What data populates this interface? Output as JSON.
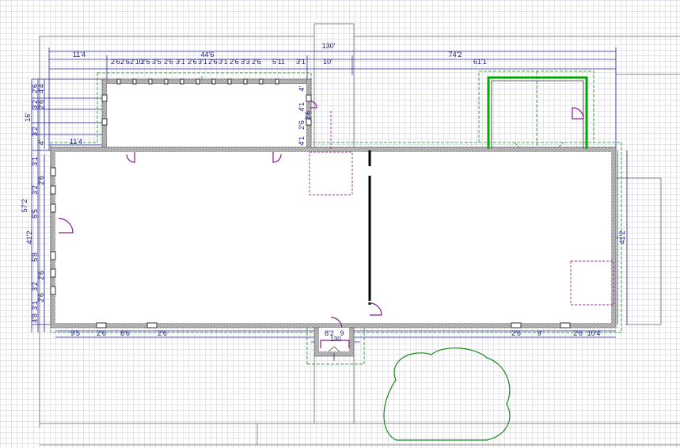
{
  "dimensions": {
    "top_outer": [
      "130'"
    ],
    "top_row1": [
      "11'4",
      "44'6",
      "74'2"
    ],
    "top_row2": [
      "2'6",
      "2'6",
      "2'10",
      "2'6",
      "3'5",
      "2'6",
      "3'1",
      "2'6",
      "3'1",
      "2'6",
      "3'1",
      "2'6",
      "3'3",
      "2'6",
      "5'11",
      "3'1",
      "10'",
      "61'1"
    ],
    "left_mid_label": "11'4",
    "left_vertical": [
      "16'",
      "57'2",
      "41'2"
    ],
    "left_small": [
      "2'6",
      "4'4",
      "3'2",
      "2'6",
      "3'2",
      "4'",
      "3'1",
      "2'6",
      "3'2",
      "6'5",
      "5'8",
      "2'6",
      "3'2",
      "2'6",
      "3'1",
      "4'8"
    ],
    "upper_right_vertical": [
      "4'1",
      "2'6",
      "4'1",
      "2'6",
      "4'"
    ],
    "right_vertical": "41'2",
    "bottom_left": [
      "9'5",
      "2'6",
      "8'6",
      "2'6"
    ],
    "bottom_mid": [
      "8'2",
      "9",
      "130"
    ],
    "bottom_right": [
      "2'6",
      "9'",
      "2'6",
      "10'4"
    ]
  },
  "icons": {
    "compass": "compass-rose-icon",
    "tree": "tree-icon",
    "door": "door-swing-icon",
    "window": "window-icon"
  },
  "colors": {
    "dimension": "#1a1a80",
    "roof_line": "#1a8a1a",
    "wall": "#505050",
    "door": "#8a1a8a",
    "garage_wall": "#00aa00",
    "grid": "#e3e3ea"
  }
}
